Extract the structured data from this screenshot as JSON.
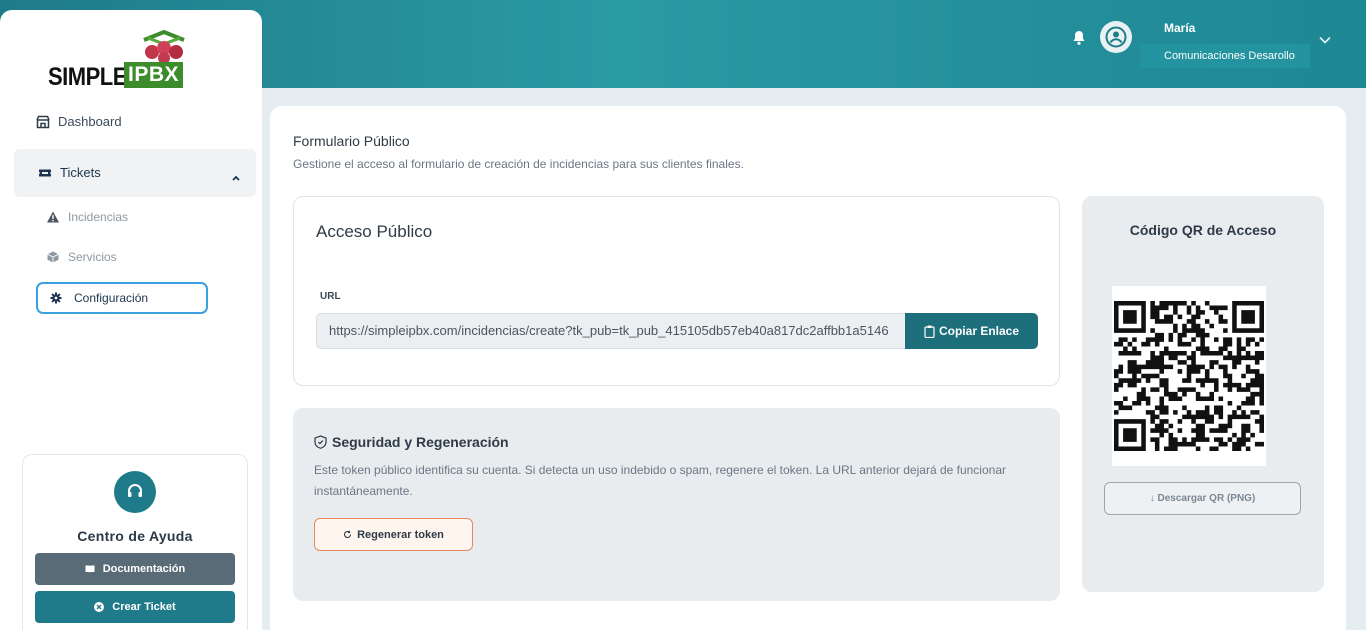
{
  "app": {
    "logo_simple": "SIMPLE",
    "logo_ipbx": "IPBX"
  },
  "header": {
    "user_name": "María",
    "user_company": "Comunicaciones Desarollo"
  },
  "sidebar": {
    "items": [
      {
        "label": "Dashboard",
        "icon": "store-icon"
      },
      {
        "label": "Tickets",
        "icon": "ticket-icon"
      },
      {
        "label": "Incidencias",
        "icon": "warning-icon"
      },
      {
        "label": "Servicios",
        "icon": "box-icon"
      },
      {
        "label": "Configuración",
        "icon": "gear-icon"
      }
    ],
    "help": {
      "title": "Centro de Ayuda",
      "doc_label": "Documentación",
      "ticket_label": "Crear Ticket"
    }
  },
  "main": {
    "title": "Formulario Público",
    "subtitle": "Gestione el acceso al formulario de creación de incidencias para sus clientes finales.",
    "access": {
      "title": "Acceso Público",
      "url_label": "URL",
      "url_value": "https://simpleipbx.com/incidencias/create?tk_pub=tk_pub_415105db57eb40a817dc2affbb1a5146",
      "copy_label": "Copiar Enlace"
    },
    "security": {
      "title": "Seguridad y Regeneración",
      "description": "Este token público identifica su cuenta. Si detecta un uso indebido o spam, regenere el token. La URL anterior dejará de funcionar instantáneamente.",
      "regen_label": "Regenerar token"
    },
    "qr": {
      "title": "Código QR de Acceso",
      "download_label": "↓ Descargar QR (PNG)"
    }
  },
  "colors": {
    "brand": "#1f7b8a",
    "accent_blue": "#3aa0e0",
    "accent_orange": "#e9885e"
  }
}
